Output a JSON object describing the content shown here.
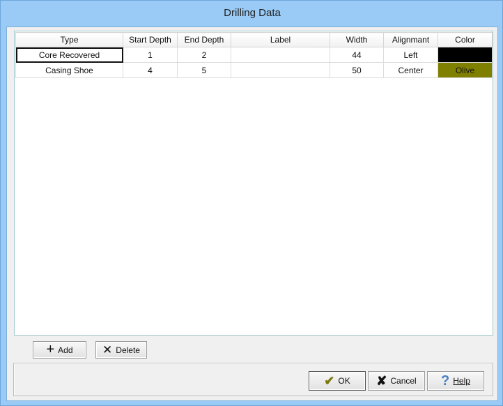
{
  "window": {
    "title": "Drilling Data"
  },
  "grid": {
    "columns": [
      "Type",
      "Start Depth",
      "End Depth",
      "Label",
      "Width",
      "Alignmant",
      "Color"
    ],
    "rows": [
      {
        "type": "Core Recovered",
        "start_depth": "1",
        "end_depth": "2",
        "label": "",
        "width": "44",
        "alignment": "Left",
        "color": "",
        "color_hex": "#000000"
      },
      {
        "type": "Casing Shoe",
        "start_depth": "4",
        "end_depth": "5",
        "label": "",
        "width": "50",
        "alignment": "Center",
        "color": "Olive",
        "color_hex": "#808000"
      }
    ]
  },
  "buttons": {
    "add": "Add",
    "delete": "Delete",
    "ok": "OK",
    "cancel": "Cancel",
    "help": "Help"
  },
  "icons": {
    "add": "plus-icon",
    "delete": "x-icon",
    "ok": "checkmark-icon",
    "cancel": "x-icon",
    "help": "question-icon"
  }
}
